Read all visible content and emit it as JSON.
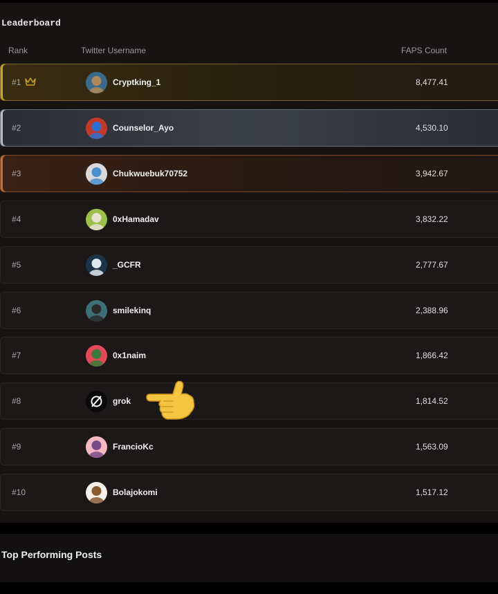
{
  "leaderboard": {
    "title": "Leaderboard",
    "headers": {
      "rank": "Rank",
      "username": "Twitter Username",
      "count": "FAPS Count"
    },
    "rows": [
      {
        "rank": "#1",
        "username": "Cryptking_1",
        "count": "8,477.41",
        "tier": "gold",
        "crown": true,
        "avatar": {
          "bg": "#3a6a8a",
          "fg": "#b08a56"
        }
      },
      {
        "rank": "#2",
        "username": "Counselor_Ayo",
        "count": "4,530.10",
        "tier": "silver",
        "avatar": {
          "bg": "#c0392b",
          "fg": "#2d6fd1"
        }
      },
      {
        "rank": "#3",
        "username": "Chukwuebuk70752",
        "count": "3,942.67",
        "tier": "bronze",
        "avatar": {
          "bg": "#d9d9d9",
          "fg": "#4a8fd0"
        }
      },
      {
        "rank": "#4",
        "username": "0xHamadav",
        "count": "3,832.22",
        "tier": "normal",
        "avatar": {
          "bg": "#9cc04a",
          "fg": "#e8e0d0"
        }
      },
      {
        "rank": "#5",
        "username": "_GCFR",
        "count": "2,777.67",
        "tier": "normal",
        "avatar": {
          "bg": "#1d3448",
          "fg": "#dfe8ef"
        }
      },
      {
        "rank": "#6",
        "username": "smilekinq",
        "count": "2,388.96",
        "tier": "normal",
        "avatar": {
          "bg": "#3f6f76",
          "fg": "#2a2a2a"
        }
      },
      {
        "rank": "#7",
        "username": "0x1naim",
        "count": "1,866.42",
        "tier": "normal",
        "avatar": {
          "bg": "#e24a5a",
          "fg": "#3a7a3a"
        }
      },
      {
        "rank": "#8",
        "username": "grok",
        "count": "1,814.52",
        "tier": "normal",
        "avatar": {
          "bg": "#0a0a0a",
          "fg": "#ffffff"
        }
      },
      {
        "rank": "#9",
        "username": "FrancioKc",
        "count": "1,563.09",
        "tier": "normal",
        "avatar": {
          "bg": "#f4b9c2",
          "fg": "#7a4a8a"
        }
      },
      {
        "rank": "#10",
        "username": "Bolajokomi",
        "count": "1,517.12",
        "tier": "normal",
        "avatar": {
          "bg": "#f5f0e8",
          "fg": "#8a5a30"
        }
      }
    ]
  },
  "posts": {
    "title": "Top Performing Posts"
  },
  "icons": {
    "crown": "crown-icon",
    "pointer": "pointing-hand-icon"
  },
  "colors": {
    "gold": "#c9a227",
    "silver": "#b7bec9",
    "bronze": "#c8702f",
    "background": "#161312"
  }
}
